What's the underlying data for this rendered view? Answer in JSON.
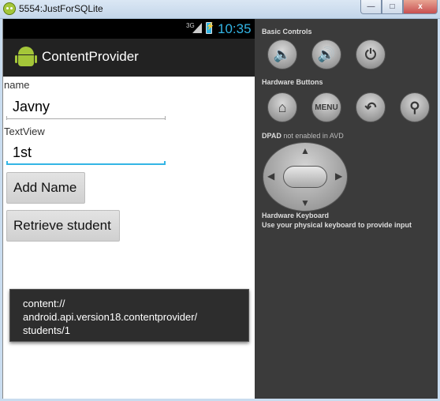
{
  "window": {
    "title": "5554:JustForSQLite",
    "minimize": "—",
    "maximize": "□",
    "close": "x"
  },
  "statusbar": {
    "network": "3G",
    "time": "10:35"
  },
  "actionbar": {
    "title": "ContentProvider"
  },
  "form": {
    "name_label": "name",
    "name_value": "Javny",
    "textview_label": "TextView",
    "grade_value": "1st",
    "add_button": "Add Name",
    "retrieve_button": "Retrieve student"
  },
  "toast": {
    "line1": "content://",
    "line2": "android.api.version18.contentprovider/",
    "line3": "students/1"
  },
  "controls": {
    "basic_title": "Basic Controls",
    "hardware_title": "Hardware Buttons",
    "menu_label": "MENU",
    "dpad_title": "DPAD",
    "dpad_note": "not enabled in AVD",
    "keyboard_title": "Hardware Keyboard",
    "keyboard_hint": "Use your physical keyboard to provide input"
  },
  "icons": {
    "volume_down": "volume-down-icon",
    "volume_up": "volume-up-icon",
    "power": "power-icon",
    "home": "home-icon",
    "back": "back-icon",
    "search": "search-icon"
  },
  "colors": {
    "accent": "#33b5e5",
    "android_green": "#a4c639"
  }
}
